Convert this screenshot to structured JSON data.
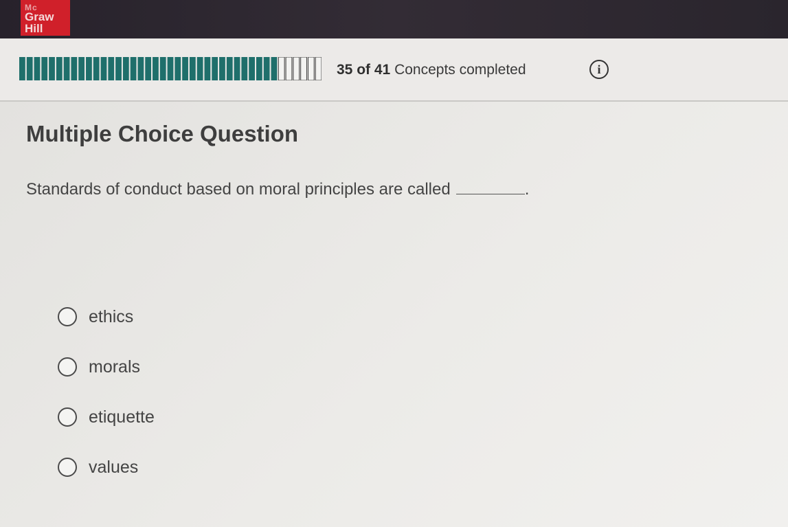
{
  "brand": {
    "logo_top": "Mc",
    "logo_line1": "Graw",
    "logo_line2": "Hill",
    "color": "#d0202a"
  },
  "progress": {
    "completed": "35",
    "of_word": "of",
    "total": "41",
    "suffix": "Concepts completed",
    "fraction_completed": 0.854,
    "info_icon": "info-icon"
  },
  "question": {
    "type_heading": "Multiple Choice Question",
    "prompt": "Standards of conduct based on moral principles are called",
    "prompt_end": ".",
    "options": [
      "ethics",
      "morals",
      "etiquette",
      "values"
    ]
  }
}
